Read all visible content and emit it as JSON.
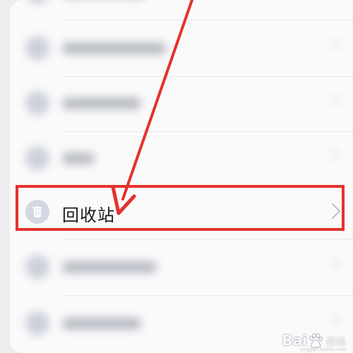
{
  "menu": {
    "highlighted_item": {
      "label": "回收站",
      "icon": "trash-icon"
    }
  },
  "annotation": {
    "color": "#e5312c"
  },
  "watermark": {
    "brand": "Bai",
    "sub": "经验",
    "url": "jingyan.baidu.com"
  }
}
